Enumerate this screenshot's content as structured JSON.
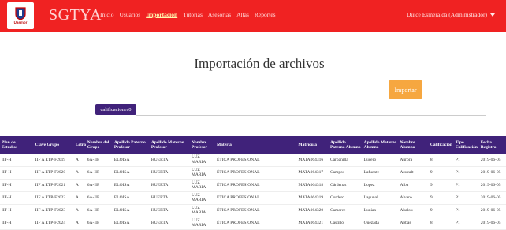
{
  "brand": {
    "logo_text": "Uasmor",
    "title": "SGTYA"
  },
  "nav": {
    "items": [
      "Inicio",
      "Usuarios",
      "Importación",
      "Tutorías",
      "Asesorías",
      "Altas",
      "Reportes"
    ],
    "active": "Importación"
  },
  "user": {
    "label": "Dulce Esmeralda (Administrador)",
    "icon": "caret-down-icon"
  },
  "page": {
    "title": "Importación de archivos",
    "import_label": "Importar",
    "file_label": "calificaciones0"
  },
  "colors": {
    "navbar": "#f02222",
    "header": "#40227a",
    "import": "#f6a740"
  },
  "table": {
    "columns": [
      "Plan de Estudios",
      "Clave Grupo",
      "Letra",
      "Nombre del Grupo",
      "Apellido Paterno Profesor",
      "Apellido Materno Profesor",
      "Nombre Profesor",
      "Materia",
      "Matrícula",
      "Apellido Paterno Alumno",
      "Apellido Materno Alumno",
      "Nombre Alumno",
      "Calificación",
      "Tipo Calificación",
      "Fecha Registro"
    ],
    "rows": [
      [
        "IIF-H",
        "IIF A ETP-F2019",
        "A",
        "6A-IIF",
        "ELOISA",
        "HUERTA",
        "LUZ MARIA",
        "ÉTICA PROFESIONAL",
        "MATA064316",
        "Carpanilla",
        "Lucero",
        "Aurora",
        "8",
        "P1",
        "2019-06-05"
      ],
      [
        "IIF-H",
        "IIF A ETP-F2020",
        "A",
        "6A-IIF",
        "ELOISA",
        "HUERTA",
        "LUZ MARIA",
        "ÉTICA PROFESIONAL",
        "MATA064317",
        "Campos",
        "Lafuente",
        "Azucalt",
        "9",
        "P1",
        "2019-06-05"
      ],
      [
        "IIF-H",
        "IIF A ETP-F2021",
        "A",
        "6A-IIF",
        "ELOISA",
        "HUERTA",
        "LUZ MARIA",
        "ÉTICA PROFESIONAL",
        "MATA064318",
        "Cárdenas",
        "Lopez",
        "Alba",
        "9",
        "P1",
        "2019-06-05"
      ],
      [
        "IIF-H",
        "IIF A ETP-F2022",
        "A",
        "6A-IIF",
        "ELOISA",
        "HUERTA",
        "LUZ MARIA",
        "ÉTICA PROFESIONAL",
        "MATA064319",
        "Cordero",
        "Lagunal",
        "Alvaro",
        "9",
        "P1",
        "2019-06-05"
      ],
      [
        "IIF-H",
        "IIF A ETP-F2023",
        "A",
        "6A-IIF",
        "ELOISA",
        "HUERTA",
        "LUZ MARIA",
        "ÉTICA PROFESIONAL",
        "MATA064320",
        "Camarce",
        "Lunian",
        "Abalou",
        "9",
        "P1",
        "2019-06-05"
      ],
      [
        "IIF-H",
        "IIF A ETP-F2024",
        "A",
        "6A-IIF",
        "ELOISA",
        "HUERTA",
        "LUZ MARIA",
        "ÉTICA PROFESIONAL",
        "MATA064321",
        "Castillo",
        "Quezada",
        "Abbas",
        "8",
        "P1",
        "2019-06-05"
      ]
    ]
  }
}
